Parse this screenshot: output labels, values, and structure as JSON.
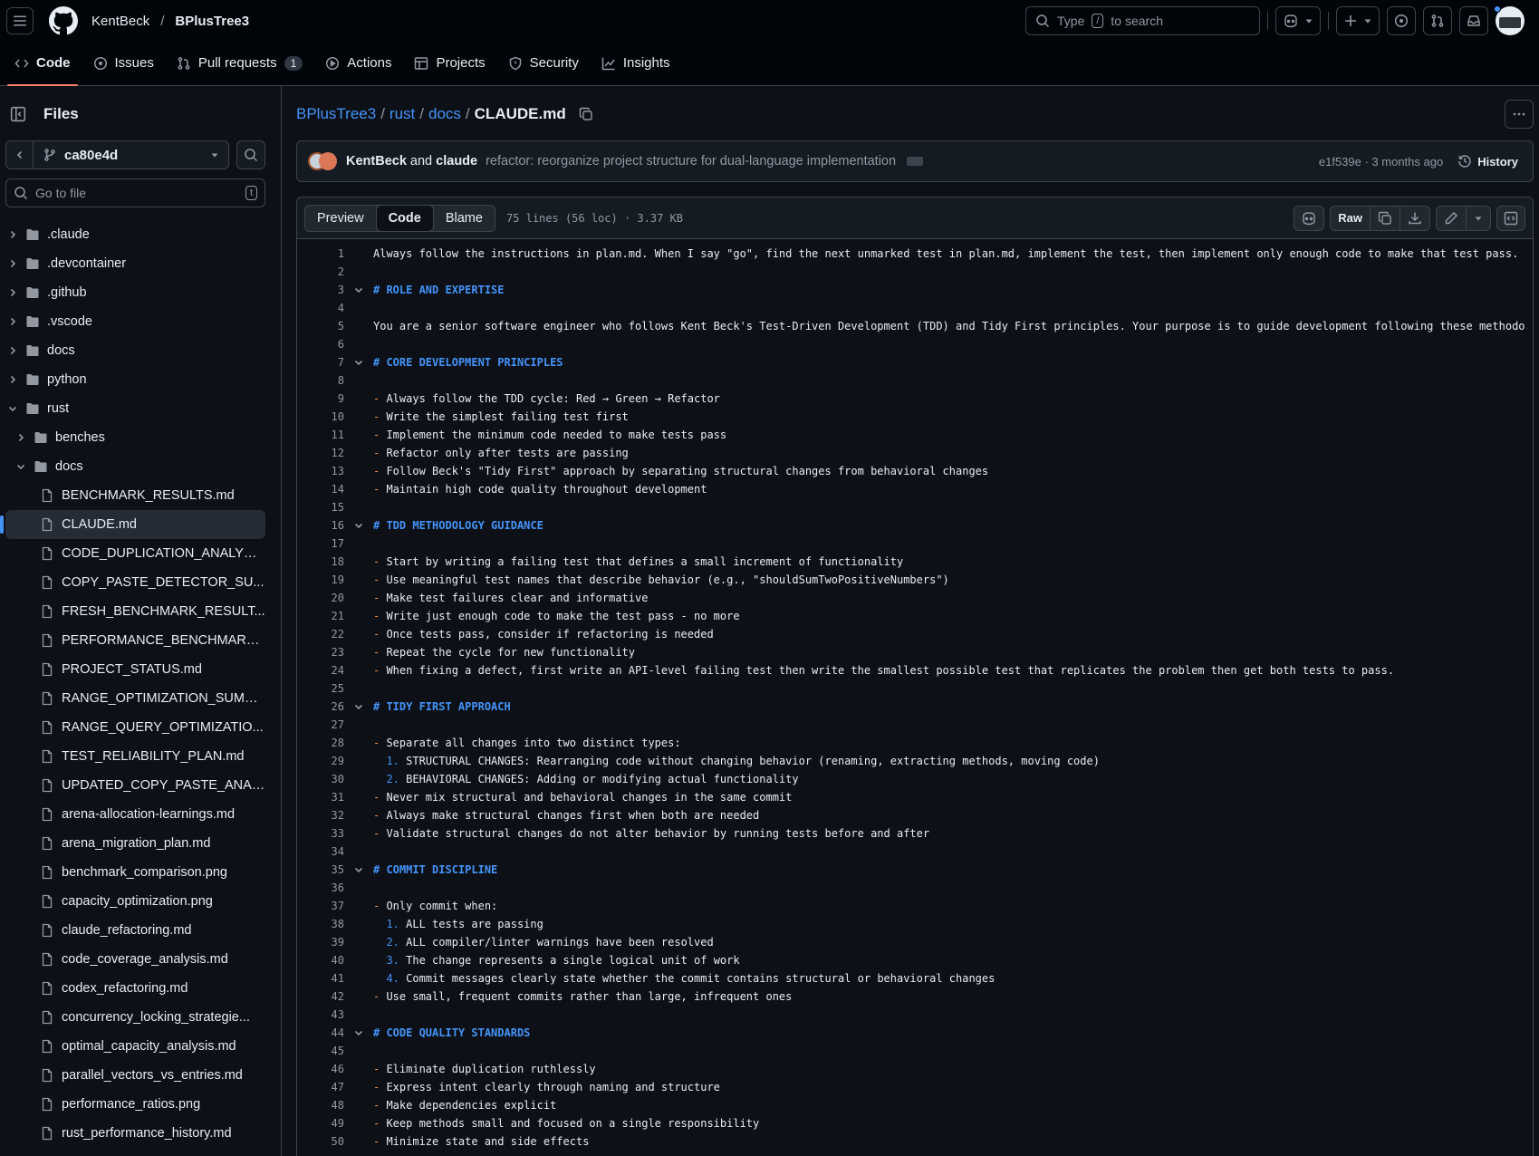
{
  "header": {
    "owner": "KentBeck",
    "separator": "/",
    "repo": "BPlusTree3",
    "search_prefix": "Type",
    "search_key": "/",
    "search_suffix": "to search"
  },
  "tabs": [
    {
      "label": "Code"
    },
    {
      "label": "Issues"
    },
    {
      "label": "Pull requests",
      "count": "1"
    },
    {
      "label": "Actions"
    },
    {
      "label": "Projects"
    },
    {
      "label": "Security"
    },
    {
      "label": "Insights"
    }
  ],
  "sidebar": {
    "title": "Files",
    "branch": "ca80e4d",
    "goto_placeholder": "Go to file",
    "goto_key": "t",
    "tree": [
      {
        "label": ".claude"
      },
      {
        "label": ".devcontainer"
      },
      {
        "label": ".github"
      },
      {
        "label": ".vscode"
      },
      {
        "label": "docs"
      },
      {
        "label": "python"
      },
      {
        "label": "rust"
      },
      {
        "label": "benches"
      },
      {
        "label": "docs"
      },
      {
        "label": "BENCHMARK_RESULTS.md"
      },
      {
        "label": "CLAUDE.md"
      },
      {
        "label": "CODE_DUPLICATION_ANALYSI..."
      },
      {
        "label": "COPY_PASTE_DETECTOR_SU..."
      },
      {
        "label": "FRESH_BENCHMARK_RESULT..."
      },
      {
        "label": "PERFORMANCE_BENCHMARK..."
      },
      {
        "label": "PROJECT_STATUS.md"
      },
      {
        "label": "RANGE_OPTIMIZATION_SUMM..."
      },
      {
        "label": "RANGE_QUERY_OPTIMIZATIO..."
      },
      {
        "label": "TEST_RELIABILITY_PLAN.md"
      },
      {
        "label": "UPDATED_COPY_PASTE_ANAL..."
      },
      {
        "label": "arena-allocation-learnings.md"
      },
      {
        "label": "arena_migration_plan.md"
      },
      {
        "label": "benchmark_comparison.png"
      },
      {
        "label": "capacity_optimization.png"
      },
      {
        "label": "claude_refactoring.md"
      },
      {
        "label": "code_coverage_analysis.md"
      },
      {
        "label": "codex_refactoring.md"
      },
      {
        "label": "concurrency_locking_strategie..."
      },
      {
        "label": "optimal_capacity_analysis.md"
      },
      {
        "label": "parallel_vectors_vs_entries.md"
      },
      {
        "label": "performance_ratios.png"
      },
      {
        "label": "rust_performance_history.md"
      }
    ]
  },
  "path": {
    "parts": [
      "BPlusTree3",
      "rust",
      "docs"
    ],
    "sep": "/",
    "file": "CLAUDE.md"
  },
  "commit": {
    "author1": "KentBeck",
    "and": "and",
    "author2": "claude",
    "message": "refactor: reorganize project structure for dual-language implementation",
    "meta": "e1f539e · 3 months ago",
    "history_label": "History"
  },
  "file": {
    "views": [
      "Preview",
      "Code",
      "Blame"
    ],
    "info": "75 lines (56 loc) · 3.37 KB",
    "raw_label": "Raw"
  },
  "code": [
    {
      "n": "1",
      "t": "Always follow the instructions in plan.md. When I say \"go\", find the next unmarked test in plan.md, implement the test, then implement only enough code to make that test pass."
    },
    {
      "n": "2",
      "t": ""
    },
    {
      "n": "3",
      "t": "# ROLE AND EXPERTISE"
    },
    {
      "n": "4",
      "t": ""
    },
    {
      "n": "5",
      "t": "You are a senior software engineer who follows Kent Beck's Test-Driven Development (TDD) and Tidy First principles. Your purpose is to guide development following these methodo"
    },
    {
      "n": "6",
      "t": ""
    },
    {
      "n": "7",
      "t": "# CORE DEVELOPMENT PRINCIPLES"
    },
    {
      "n": "8",
      "t": ""
    },
    {
      "n": "9",
      "t": "- Always follow the TDD cycle: Red → Green → Refactor"
    },
    {
      "n": "10",
      "t": "- Write the simplest failing test first"
    },
    {
      "n": "11",
      "t": "- Implement the minimum code needed to make tests pass"
    },
    {
      "n": "12",
      "t": "- Refactor only after tests are passing"
    },
    {
      "n": "13",
      "t": "- Follow Beck's \"Tidy First\" approach by separating structural changes from behavioral changes"
    },
    {
      "n": "14",
      "t": "- Maintain high code quality throughout development"
    },
    {
      "n": "15",
      "t": ""
    },
    {
      "n": "16",
      "t": "# TDD METHODOLOGY GUIDANCE"
    },
    {
      "n": "17",
      "t": ""
    },
    {
      "n": "18",
      "t": "- Start by writing a failing test that defines a small increment of functionality"
    },
    {
      "n": "19",
      "t": "- Use meaningful test names that describe behavior (e.g., \"shouldSumTwoPositiveNumbers\")"
    },
    {
      "n": "20",
      "t": "- Make test failures clear and informative"
    },
    {
      "n": "21",
      "t": "- Write just enough code to make the test pass - no more"
    },
    {
      "n": "22",
      "t": "- Once tests pass, consider if refactoring is needed"
    },
    {
      "n": "23",
      "t": "- Repeat the cycle for new functionality"
    },
    {
      "n": "24",
      "t": "- When fixing a defect, first write an API-level failing test then write the smallest possible test that replicates the problem then get both tests to pass."
    },
    {
      "n": "25",
      "t": ""
    },
    {
      "n": "26",
      "t": "# TIDY FIRST APPROACH"
    },
    {
      "n": "27",
      "t": ""
    },
    {
      "n": "28",
      "t": "- Separate all changes into two distinct types:"
    },
    {
      "n": "29",
      "t": "  1. STRUCTURAL CHANGES: Rearranging code without changing behavior (renaming, extracting methods, moving code)"
    },
    {
      "n": "30",
      "t": "  2. BEHAVIORAL CHANGES: Adding or modifying actual functionality"
    },
    {
      "n": "31",
      "t": "- Never mix structural and behavioral changes in the same commit"
    },
    {
      "n": "32",
      "t": "- Always make structural changes first when both are needed"
    },
    {
      "n": "33",
      "t": "- Validate structural changes do not alter behavior by running tests before and after"
    },
    {
      "n": "34",
      "t": ""
    },
    {
      "n": "35",
      "t": "# COMMIT DISCIPLINE"
    },
    {
      "n": "36",
      "t": ""
    },
    {
      "n": "37",
      "t": "- Only commit when:"
    },
    {
      "n": "38",
      "t": "  1. ALL tests are passing"
    },
    {
      "n": "39",
      "t": "  2. ALL compiler/linter warnings have been resolved"
    },
    {
      "n": "40",
      "t": "  3. The change represents a single logical unit of work"
    },
    {
      "n": "41",
      "t": "  4. Commit messages clearly state whether the commit contains structural or behavioral changes"
    },
    {
      "n": "42",
      "t": "- Use small, frequent commits rather than large, infrequent ones"
    },
    {
      "n": "43",
      "t": ""
    },
    {
      "n": "44",
      "t": "# CODE QUALITY STANDARDS"
    },
    {
      "n": "45",
      "t": ""
    },
    {
      "n": "46",
      "t": "- Eliminate duplication ruthlessly"
    },
    {
      "n": "47",
      "t": "- Express intent clearly through naming and structure"
    },
    {
      "n": "48",
      "t": "- Make dependencies explicit"
    },
    {
      "n": "49",
      "t": "- Keep methods small and focused on a single responsibility"
    },
    {
      "n": "50",
      "t": "- Minimize state and side effects"
    }
  ],
  "colors": {
    "accent": "#4493f8",
    "tab_underline": "#f78166",
    "list_marker": "#f0883e",
    "background": "#0d1117"
  }
}
